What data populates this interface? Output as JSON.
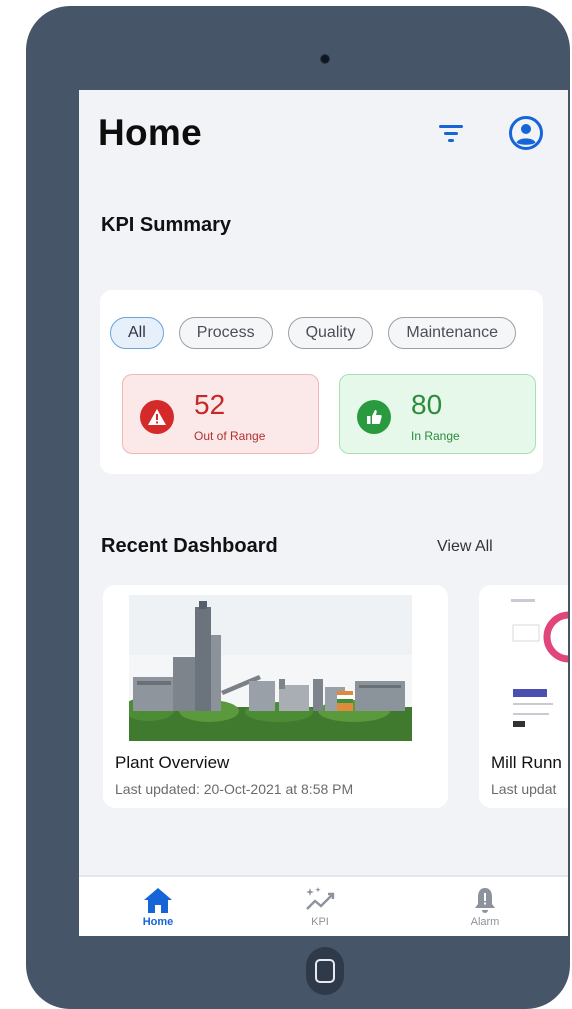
{
  "header": {
    "title": "Home",
    "filter_icon": "filter-icon",
    "profile_icon": "account-circle-icon"
  },
  "kpi_summary": {
    "title": "KPI Summary",
    "chips": [
      {
        "label": "All",
        "active": true
      },
      {
        "label": "Process",
        "active": false
      },
      {
        "label": "Quality",
        "active": false
      },
      {
        "label": "Maintenance",
        "active": false
      }
    ],
    "stats": [
      {
        "value": "52",
        "label": "Out of Range",
        "icon": "warning-icon",
        "color": "#d42a2a"
      },
      {
        "value": "80",
        "label": "In Range",
        "icon": "thumbs-up-icon",
        "color": "#2a9a3f"
      }
    ]
  },
  "recent_dashboard": {
    "title": "Recent Dashboard",
    "view_all": "View All",
    "cards": [
      {
        "name": "Plant Overview",
        "updated": "Last updated: 20-Oct-2021 at 8:58 PM"
      },
      {
        "name": "Mill Runn",
        "updated": "Last updat"
      }
    ]
  },
  "bottom_nav": {
    "items": [
      {
        "label": "Home",
        "icon": "home-icon",
        "active": true
      },
      {
        "label": "KPI",
        "icon": "sparkle-trend-icon",
        "active": false
      },
      {
        "label": "Alarm",
        "icon": "bell-icon",
        "active": false
      }
    ]
  },
  "colors": {
    "accent": "#1565d8",
    "device_frame": "#475568",
    "screen_bg": "#f2f3f7"
  }
}
